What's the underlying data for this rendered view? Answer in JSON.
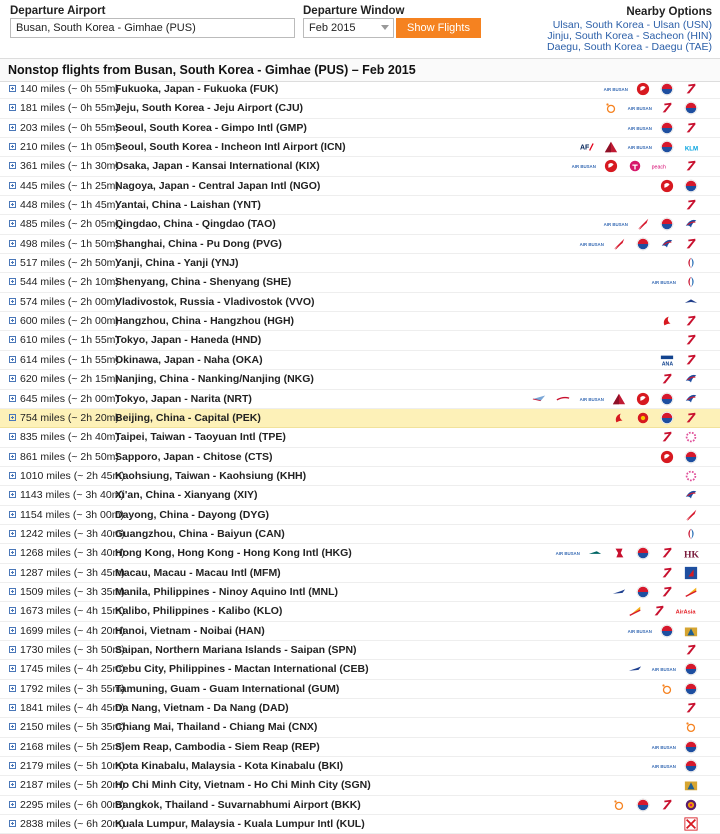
{
  "header": {
    "departure_airport_label": "Departure Airport",
    "departure_airport_value": "Busan, South Korea - Gimhae (PUS)",
    "departure_window_label": "Departure Window",
    "departure_window_value": "Feb 2015",
    "show_flights_label": "Show Flights",
    "nearby_title": "Nearby Options",
    "nearby": [
      "Ulsan, South Korea - Ulsan (USN)",
      "Jinju, South Korea - Sacheon (HIN)",
      "Daegu, South Korea - Daegu (TAE)"
    ]
  },
  "title": "Nonstop flights from Busan, South Korea - Gimhae (PUS) – Feb 2015",
  "colors": {
    "accent": "#f58220",
    "link": "#2b5fa8",
    "highlight": "#fdf1b8"
  },
  "flights": [
    {
      "dist": "140 miles (~ 0h 55m)",
      "dest": "Fukuoka, Japan - Fukuoka (FUK)",
      "airlines": [
        "air-busan-icon",
        "japan-airlines-icon",
        "korean-air-icon",
        "asiana-icon"
      ]
    },
    {
      "dist": "181 miles (~ 0h 55m)",
      "dest": "Jeju, South Korea - Jeju Airport (CJU)",
      "airlines": [
        "jeju-air-icon",
        "air-busan-icon",
        "asiana-icon",
        "korean-air-icon"
      ]
    },
    {
      "dist": "203 miles (~ 0h 55m)",
      "dest": "Seoul, South Korea - Gimpo Intl (GMP)",
      "airlines": [
        "air-busan-icon",
        "korean-air-icon",
        "asiana-icon"
      ]
    },
    {
      "dist": "210 miles (~ 1h 05m)",
      "dest": "Seoul, South Korea - Incheon Intl Airport (ICN)",
      "airlines": [
        "air-france-icon",
        "delta-icon",
        "air-busan-icon",
        "korean-air-icon",
        "klm-icon"
      ]
    },
    {
      "dist": "361 miles (~ 1h 30m)",
      "dest": "Osaka, Japan - Kansai International (KIX)",
      "airlines": [
        "air-busan-icon",
        "japan-airlines-icon",
        "t-way-icon",
        "peach-icon",
        "asiana-icon"
      ]
    },
    {
      "dist": "445 miles (~ 1h 25m)",
      "dest": "Nagoya, Japan - Central Japan Intl (NGO)",
      "airlines": [
        "japan-airlines-icon",
        "korean-air-icon"
      ]
    },
    {
      "dist": "448 miles (~ 1h 45m)",
      "dest": "Yantai, China - Laishan (YNT)",
      "airlines": [
        "asiana-icon"
      ]
    },
    {
      "dist": "485 miles (~ 2h 05m)",
      "dest": "Qingdao, China - Qingdao (TAO)",
      "airlines": [
        "air-busan-icon",
        "shandong-icon",
        "korean-air-icon",
        "china-eastern-icon"
      ]
    },
    {
      "dist": "498 miles (~ 1h 50m)",
      "dest": "Shanghai, China - Pu Dong (PVG)",
      "airlines": [
        "air-busan-icon",
        "shandong-icon",
        "korean-air-icon",
        "china-eastern-icon",
        "asiana-icon"
      ]
    },
    {
      "dist": "517 miles (~ 2h 50m)",
      "dest": "Yanji, China - Yanji (YNJ)",
      "airlines": [
        "china-southern-icon"
      ]
    },
    {
      "dist": "544 miles (~ 2h 10m)",
      "dest": "Shenyang, China - Shenyang (SHE)",
      "airlines": [
        "air-busan-icon",
        "china-southern-icon"
      ]
    },
    {
      "dist": "574 miles (~ 2h 00m)",
      "dest": "Vladivostok, Russia - Vladivostok (VVO)",
      "airlines": [
        "aurora-icon"
      ]
    },
    {
      "dist": "600 miles (~ 2h 00m)",
      "dest": "Hangzhou, China - Hangzhou (HGH)",
      "airlines": [
        "air-china-icon",
        "asiana-icon"
      ]
    },
    {
      "dist": "610 miles (~ 1h 55m)",
      "dest": "Tokyo, Japan - Haneda (HND)",
      "airlines": [
        "asiana-icon"
      ]
    },
    {
      "dist": "614 miles (~ 1h 55m)",
      "dest": "Okinawa, Japan - Naha (OKA)",
      "airlines": [
        "ana-icon",
        "asiana-icon"
      ]
    },
    {
      "dist": "620 miles (~ 2h 15m)",
      "dest": "Nanjing, China - Nanking/Nanjing (NKG)",
      "airlines": [
        "asiana-icon",
        "china-eastern-icon"
      ]
    },
    {
      "dist": "645 miles (~ 2h 00m)",
      "dest": "Tokyo, Japan - Narita (NRT)",
      "airlines": [
        "american-icon",
        "british-icon",
        "air-busan-icon",
        "delta-icon",
        "japan-airlines-icon",
        "korean-air-icon",
        "china-eastern-icon"
      ]
    },
    {
      "dist": "754 miles (~ 2h 20m)",
      "dest": "Beijing, China - Capital (PEK)",
      "airlines": [
        "air-china-icon",
        "hainan-icon",
        "korean-air-icon",
        "asiana-icon"
      ],
      "highlight": true
    },
    {
      "dist": "835 miles (~ 2h 40m)",
      "dest": "Taipei, Taiwan - Taoyuan Intl (TPE)",
      "airlines": [
        "asiana-icon",
        "china-airlines-icon"
      ]
    },
    {
      "dist": "861 miles (~ 2h 50m)",
      "dest": "Sapporo, Japan - Chitose (CTS)",
      "airlines": [
        "japan-airlines-icon",
        "korean-air-icon"
      ]
    },
    {
      "dist": "1010 miles (~ 2h 45m)",
      "dest": "Kaohsiung, Taiwan - Kaohsiung (KHH)",
      "airlines": [
        "china-airlines-icon"
      ]
    },
    {
      "dist": "1143 miles (~ 3h 40m)",
      "dest": "Xi'an, China - Xianyang (XIY)",
      "airlines": [
        "china-eastern-icon"
      ]
    },
    {
      "dist": "1154 miles (~ 3h 00m)",
      "dest": "Dayong, China - Dayong (DYG)",
      "airlines": [
        "shandong-icon"
      ]
    },
    {
      "dist": "1242 miles (~ 3h 40m)",
      "dest": "Guangzhou, China - Baiyun (CAN)",
      "airlines": [
        "china-southern-icon"
      ]
    },
    {
      "dist": "1268 miles (~ 3h 40m)",
      "dest": "Hong Kong, Hong Kong - Hong Kong Intl (HKG)",
      "airlines": [
        "air-busan-icon",
        "cathay-icon",
        "dragonair-icon",
        "korean-air-icon",
        "asiana-icon",
        "hk-airlines-icon"
      ]
    },
    {
      "dist": "1287 miles (~ 3h 45m)",
      "dest": "Macau, Macau - Macau Intl (MFM)",
      "airlines": [
        "asiana-icon",
        "air-macau-icon"
      ]
    },
    {
      "dist": "1509 miles (~ 3h 35m)",
      "dest": "Manila, Philippines - Ninoy Aquino Intl (MNL)",
      "airlines": [
        "philippine-icon",
        "korean-air-icon",
        "asiana-icon",
        "cebu-icon"
      ]
    },
    {
      "dist": "1673 miles (~ 4h 15m)",
      "dest": "Kalibo, Philippines - Kalibo (KLO)",
      "airlines": [
        "cebu-icon",
        "asiana-icon",
        "airasia-icon"
      ]
    },
    {
      "dist": "1699 miles (~ 4h 20m)",
      "dest": "Hanoi, Vietnam - Noibai (HAN)",
      "airlines": [
        "air-busan-icon",
        "korean-air-icon",
        "vietnam-icon"
      ]
    },
    {
      "dist": "1730 miles (~ 3h 50m)",
      "dest": "Saipan, Northern Mariana Islands - Saipan (SPN)",
      "airlines": [
        "asiana-icon"
      ]
    },
    {
      "dist": "1745 miles (~ 4h 25m)",
      "dest": "Cebu City, Philippines - Mactan International (CEB)",
      "airlines": [
        "philippine-icon",
        "air-busan-icon",
        "korean-air-icon"
      ]
    },
    {
      "dist": "1792 miles (~ 3h 55m)",
      "dest": "Tamuning, Guam - Guam International (GUM)",
      "airlines": [
        "jeju-air-icon",
        "korean-air-icon"
      ]
    },
    {
      "dist": "1841 miles (~ 4h 45m)",
      "dest": "Da Nang, Vietnam - Da Nang (DAD)",
      "airlines": [
        "asiana-icon"
      ]
    },
    {
      "dist": "2150 miles (~ 5h 35m)",
      "dest": "Chiang Mai, Thailand - Chiang Mai (CNX)",
      "airlines": [
        "jeju-air-icon"
      ]
    },
    {
      "dist": "2168 miles (~ 5h 25m)",
      "dest": "Siem Reap, Cambodia - Siem Reap (REP)",
      "airlines": [
        "air-busan-icon",
        "korean-air-icon"
      ]
    },
    {
      "dist": "2179 miles (~ 5h 10m)",
      "dest": "Kota Kinabalu, Malaysia - Kota Kinabalu (BKI)",
      "airlines": [
        "air-busan-icon",
        "korean-air-icon"
      ]
    },
    {
      "dist": "2187 miles (~ 5h 20m)",
      "dest": "Ho Chi Minh City, Vietnam - Ho Chi Minh City (SGN)",
      "airlines": [
        "vietnam-icon"
      ]
    },
    {
      "dist": "2295 miles (~ 6h 00m)",
      "dest": "Bangkok, Thailand - Suvarnabhumi Airport (BKK)",
      "airlines": [
        "jeju-air-icon",
        "korean-air-icon",
        "asiana-icon",
        "thai-icon"
      ]
    },
    {
      "dist": "2838 miles (~ 6h 20m)",
      "dest": "Kuala Lumpur, Malaysia - Kuala Lumpur Intl (KUL)",
      "airlines": [
        "malaysia-icon"
      ]
    }
  ]
}
